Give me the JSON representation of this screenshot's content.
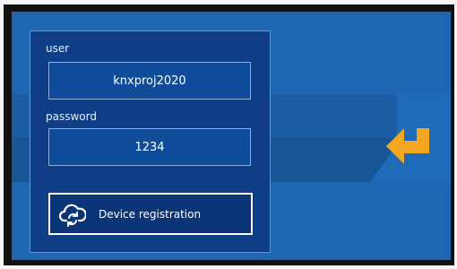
{
  "login": {
    "user_label": "user",
    "user_value": "knxproj2020",
    "password_label": "password",
    "password_value": "1234",
    "device_registration_label": "Device registration"
  },
  "icons": {
    "registration": "cloud-sync-icon",
    "enter": "enter-arrow-icon"
  },
  "colors": {
    "background": "#1e66b2",
    "panel": "#103e86",
    "accent": "#f5a623"
  }
}
